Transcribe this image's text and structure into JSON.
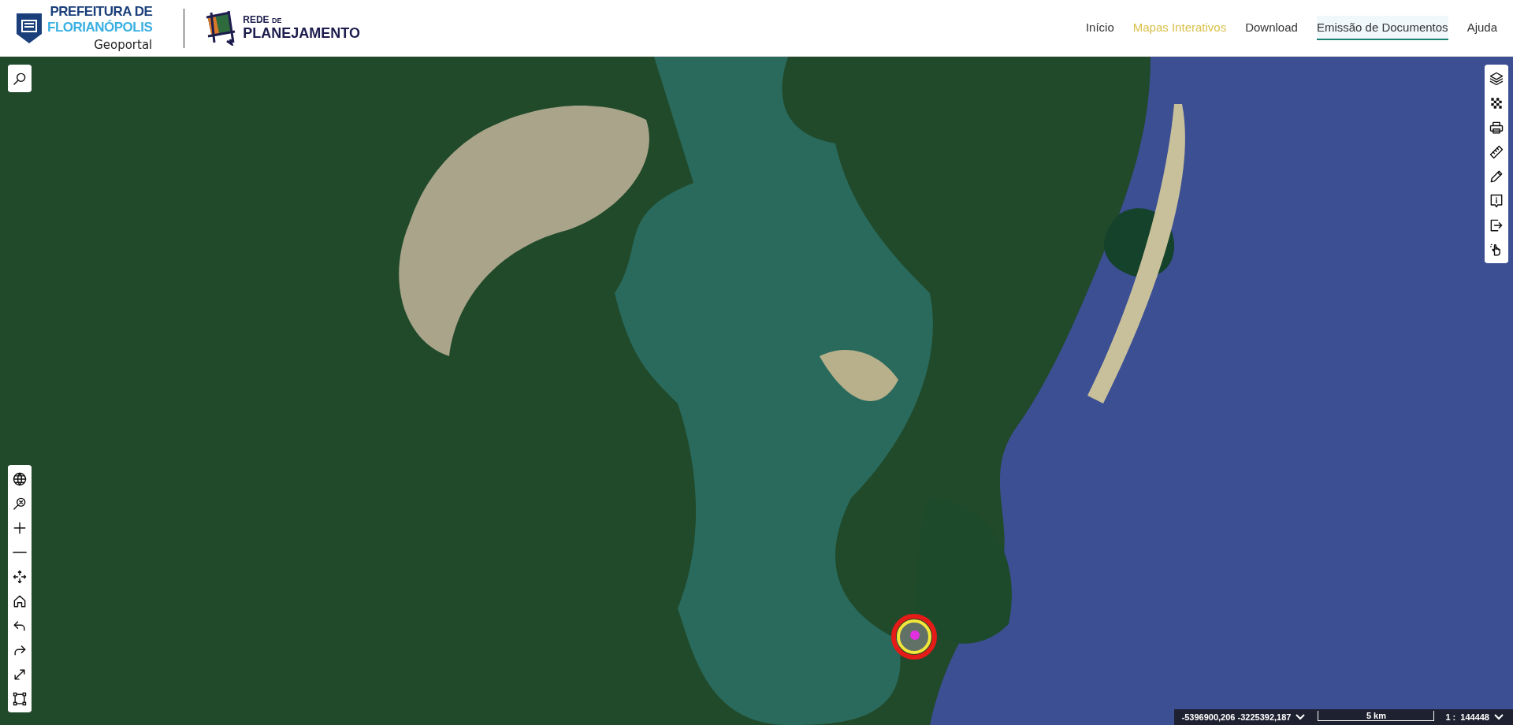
{
  "header": {
    "logo_top": "PREFEITURA DE",
    "logo_bottom": "FLORIANÓPOLIS",
    "logo_sub": "Geoportal",
    "partner_top": "REDE",
    "partner_top_small": "DE",
    "partner_bottom": "PLANEJAMENTO"
  },
  "nav": [
    {
      "label": "Início",
      "selected": false,
      "highlighted": false
    },
    {
      "label": "Mapas Interativos",
      "selected": false,
      "highlighted": true
    },
    {
      "label": "Download",
      "selected": false,
      "highlighted": false
    },
    {
      "label": "Emissão de Documentos",
      "selected": true,
      "highlighted": false
    },
    {
      "label": "Ajuda",
      "selected": false,
      "highlighted": false
    }
  ],
  "right_tools": [
    {
      "kind": "layers"
    },
    {
      "kind": "checker"
    },
    {
      "kind": "print"
    },
    {
      "kind": "ruler"
    },
    {
      "kind": "pencil"
    },
    {
      "kind": "info"
    },
    {
      "kind": "exit"
    },
    {
      "kind": "hand"
    }
  ],
  "left_tools": [
    {
      "kind": "globe"
    },
    {
      "kind": "zoomx"
    },
    {
      "kind": "plus"
    },
    {
      "kind": "minus"
    },
    {
      "kind": "move"
    },
    {
      "kind": "home"
    },
    {
      "kind": "undo"
    },
    {
      "kind": "redo"
    },
    {
      "kind": "expand"
    },
    {
      "kind": "select"
    }
  ],
  "status_bar": {
    "coordinates": "-5396900,206 -3225392,187",
    "scale_bar": "5 km",
    "scale_prefix": "1 :",
    "scale_value": "144448"
  }
}
